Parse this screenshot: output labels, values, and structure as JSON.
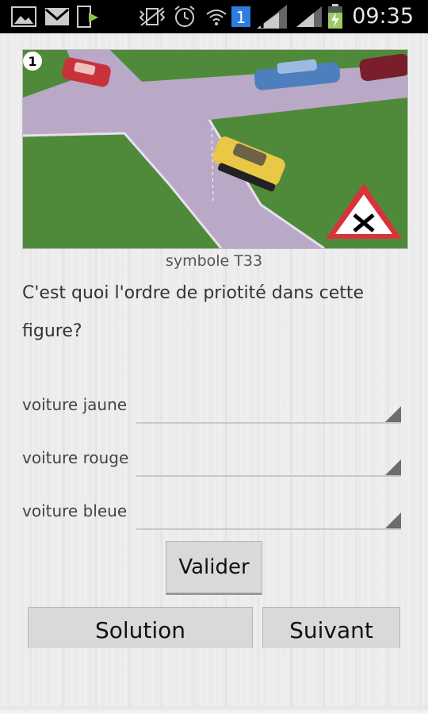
{
  "status_bar": {
    "time": "09:35",
    "icons": [
      "picture-icon",
      "gmail-icon",
      "download-icon",
      "vibrate-icon",
      "alarm-icon",
      "wifi-icon",
      "sim-1-icon",
      "signal-icon",
      "signal-icon",
      "battery-charging-icon"
    ],
    "sim_badge": "1"
  },
  "figure": {
    "number": "1",
    "caption": "symbole T33"
  },
  "question": "C'est quoi l'ordre de priotité dans cette figure?",
  "answers": [
    {
      "label": "voiture jaune",
      "value": ""
    },
    {
      "label": "voiture rouge",
      "value": ""
    },
    {
      "label": "voiture bleue",
      "value": ""
    }
  ],
  "buttons": {
    "validate": "Valider",
    "solution": "Solution",
    "next": "Suivant"
  },
  "colors": {
    "grass": "#4f8a3a",
    "road": "#b9a9c6",
    "car_red": "#c8323a",
    "car_blue": "#4d7fbf",
    "car_yellow": "#e9c845",
    "sign_red": "#d8323a"
  }
}
